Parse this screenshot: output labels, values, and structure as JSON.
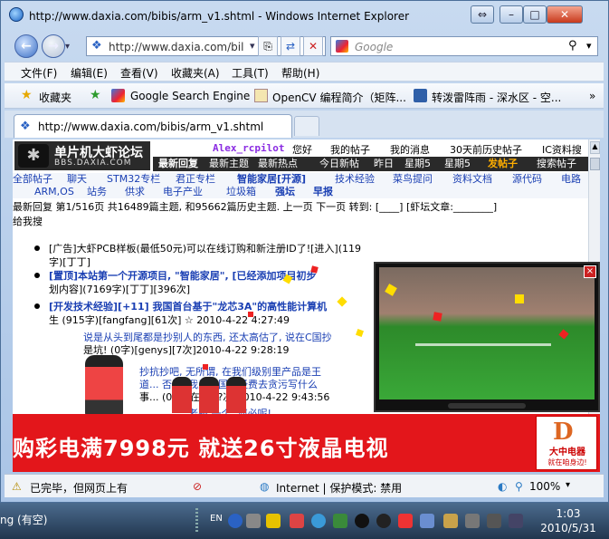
{
  "window": {
    "title": "http://www.daxia.com/bibis/arm_v1.shtml - Windows Internet Explorer",
    "address": "http://www.daxia.com/bil",
    "search_placeholder": "Google"
  },
  "menu": [
    "文件(F)",
    "编辑(E)",
    "查看(V)",
    "收藏夹(A)",
    "工具(T)",
    "帮助(H)"
  ],
  "favorites": {
    "label": "收藏夹",
    "items": [
      "Google Search Engine",
      "OpenCV 编程简介（矩阵...",
      "转泼雷阵雨 - 深水区 - 空..."
    ]
  },
  "tab": {
    "title": "http://www.daxia.com/bibis/arm_v1.shtml"
  },
  "site": {
    "logo_title": "单片机大虾论坛",
    "logo_url": "BBS.DAXIA.COM",
    "user": "Alex_rcpilot",
    "greeting": "您好",
    "top_links": [
      "我的帖子",
      "我的消息",
      "30天前历史帖子",
      "IC资料搜"
    ],
    "nav_links": [
      "最新回复",
      "最新主题",
      "最新热点",
      "今日新帖",
      "昨日",
      "星期5",
      "星期5",
      "发帖子",
      "搜索帖子"
    ],
    "categories": [
      "全部帖子",
      "聊天",
      "STM32专栏",
      "君正专栏",
      "智能家居[开源]",
      "技术经验",
      "菜鸟提问",
      "资料文档",
      "源代码",
      "电路",
      "ARM,OS",
      "站务",
      "供求",
      "电子产业",
      "垃圾箱",
      "强坛",
      "早报"
    ],
    "paging": "最新回复 第1/516页 共16489篇主题, 和95662篇历史主题. 上一页 下一页 转到: [____] [虾坛文章:________]",
    "reply_me": "给我搜",
    "posts": [
      "[广告]大虾PCB样板(最低50元)可以在线订购和新注册ID了![进入](119",
      "字)[丁丁]",
      "[置顶]本站第一个开源项目, \"智能家居\", [已经添加项目初步",
      "划内容](7169字)[丁丁][396次]",
      "[开发技术经验][+11]  我国首台基于\"龙芯3A\"的高性能计算机",
      "生 (915字)[fangfang][61次] ☆ 2010-4-22 4:27:49",
      "说是从头到尾都是抄别人的东西, 还太高估了, 说在C国抄",
      "是坑! (0字)[genys][7次]2010-4-22 9:28:19",
      "抄抗抄吧, 无所谓, 在我们级别里产品是王",
      "道... 否则, 我只骗国家经费去贪污写什么",
      "事... (0字)[在线][?次]2010-4-22 9:43:56",
      "... 老跑 一个, 何必呢!"
    ]
  },
  "ad": {
    "headline": "购彩电满7998元 就送26寸液晶电视",
    "brand_letter": "D",
    "brand_name": "大中电器",
    "brand_slogan": "就在咱身边!",
    "close": "×"
  },
  "status": {
    "left": "已完毕，但网页上有",
    "zone": "Internet | 保护模式: 禁用",
    "zoom": "100%"
  },
  "taskbar": {
    "item": "ng (有空)",
    "lang": "EN",
    "time": "1:03",
    "date": "2010/5/31"
  }
}
